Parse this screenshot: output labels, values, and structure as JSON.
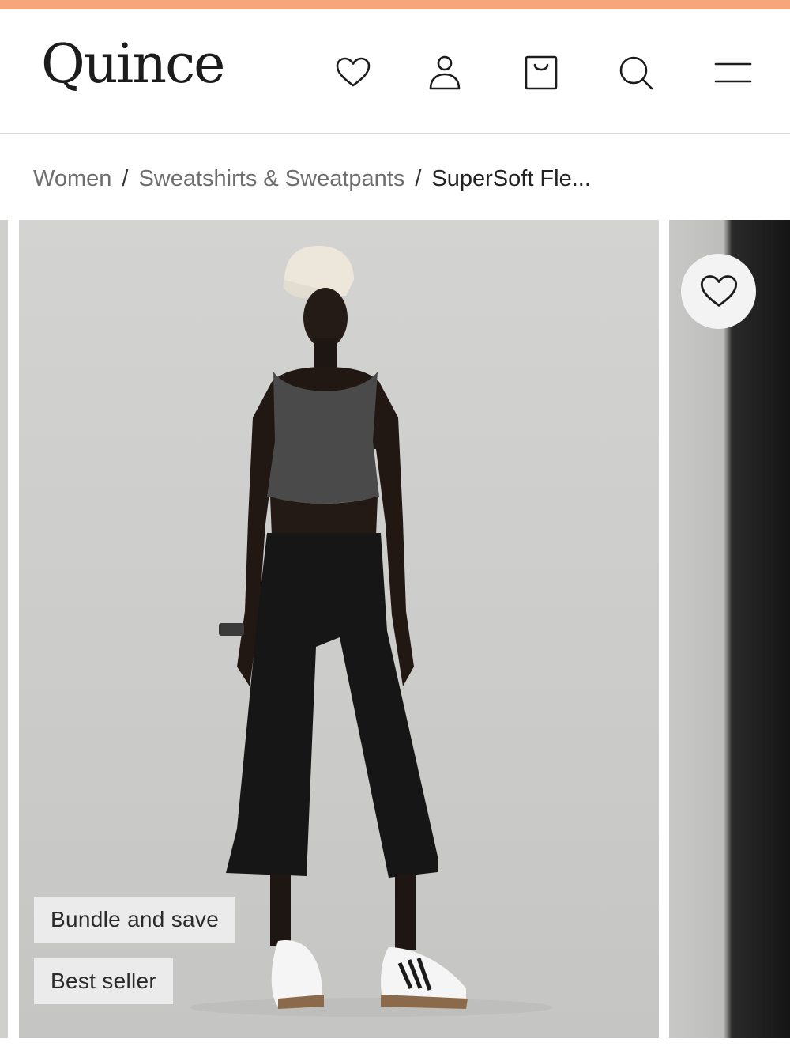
{
  "colors": {
    "promo_bar": "#f6a67a",
    "text_primary": "#222222",
    "text_muted": "#6e6e6e"
  },
  "header": {
    "logo_text": "Quince",
    "icons": [
      "heart-icon",
      "user-icon",
      "shopping-bag-icon",
      "search-icon",
      "menu-icon"
    ]
  },
  "breadcrumb": {
    "items": [
      "Women",
      "Sweatshirts & Sweatpants"
    ],
    "separator": "/",
    "current": "SuperSoft Fle..."
  },
  "gallery": {
    "badges": [
      "Bundle and save",
      "Best seller"
    ],
    "favorite_icon": "heart-icon"
  }
}
